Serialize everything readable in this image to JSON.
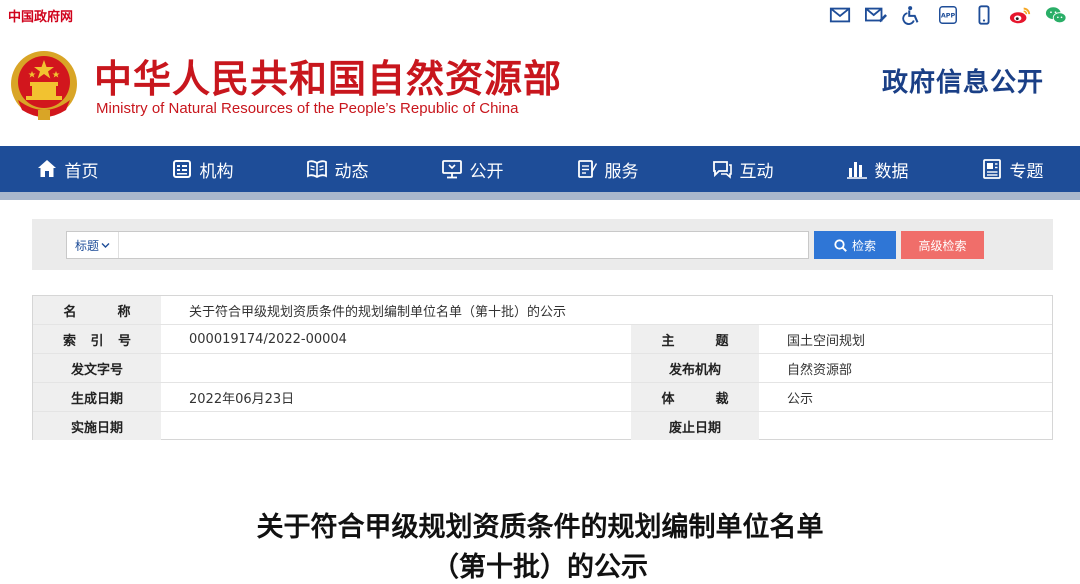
{
  "topbar": {
    "gov_link": "中国政府网",
    "icons": [
      "mail-icon",
      "mail-edit-icon",
      "accessibility-icon",
      "app-icon",
      "mobile-icon",
      "weibo-icon",
      "wechat-icon"
    ]
  },
  "header": {
    "ministry_cn": "中华人民共和国自然资源部",
    "ministry_en": "Ministry of Natural Resources of the People’s Republic of China",
    "gov_info": "政府信息公开"
  },
  "nav": {
    "items": [
      {
        "label": "首页",
        "icon": "home-icon"
      },
      {
        "label": "机构",
        "icon": "organization-icon"
      },
      {
        "label": "动态",
        "icon": "news-icon"
      },
      {
        "label": "公开",
        "icon": "disclosure-icon"
      },
      {
        "label": "服务",
        "icon": "service-icon"
      },
      {
        "label": "互动",
        "icon": "interaction-icon"
      },
      {
        "label": "数据",
        "icon": "data-icon"
      },
      {
        "label": "专题",
        "icon": "topic-icon"
      }
    ]
  },
  "search": {
    "type_label": "标题",
    "placeholder": "",
    "search_button": "检索",
    "advanced_button": "高级检索"
  },
  "info": {
    "name_label": "名　称",
    "name_value": "关于符合甲级规划资质条件的规划编制单位名单（第十批）的公示",
    "index_label": "索 引 号",
    "index_value": "000019174/2022-00004",
    "subject_label": "主　题",
    "subject_value": "国土空间规划",
    "doc_no_label": "发文字号",
    "doc_no_value": "",
    "publisher_label": "发布机构",
    "publisher_value": "自然资源部",
    "created_label": "生成日期",
    "created_value": "2022年06月23日",
    "genre_label": "体　裁",
    "genre_value": "公示",
    "effective_label": "实施日期",
    "effective_value": "",
    "abolished_label": "废止日期",
    "abolished_value": ""
  },
  "article": {
    "title_line1": "关于符合甲级规划资质条件的规划编制单位名单",
    "title_line2": "（第十批）的公示"
  },
  "colors": {
    "brand_red": "#c8161d",
    "nav_blue": "#1e4d98",
    "search_blue": "#2f76d6",
    "advanced_red": "#f06e6a"
  }
}
